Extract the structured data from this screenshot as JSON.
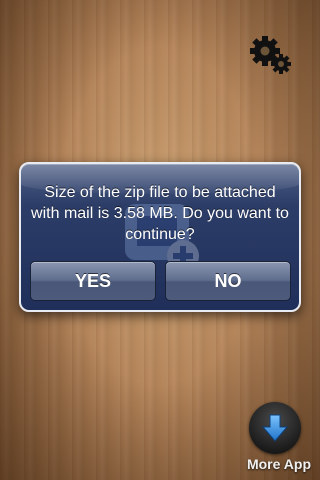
{
  "dialog": {
    "message": "Size of the zip file to be attached with mail is 3.58 MB. Do you want to continue?",
    "yes_label": "YES",
    "no_label": "NO"
  },
  "more_app": {
    "label": "More App"
  },
  "icons": {
    "settings": "gear-icon",
    "more_app": "download-arrow-icon"
  },
  "colors": {
    "dialog_bg": "#1f2f5a",
    "dialog_border": "#e8ecf2",
    "button": "#5f6d8e",
    "arrow": "#2f8fe0"
  }
}
